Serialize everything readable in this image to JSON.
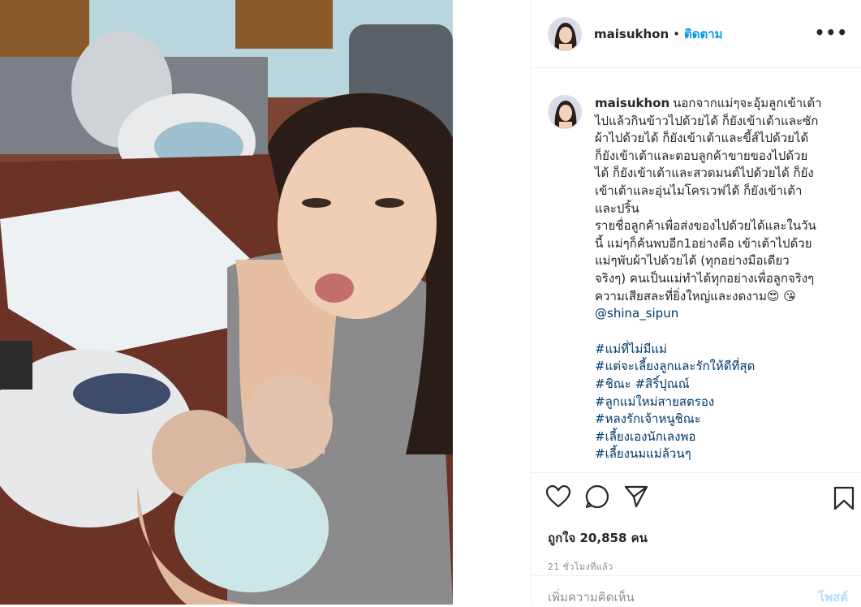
{
  "post": {
    "username": "maisukhon",
    "separator": "•",
    "follow_label": "ติดตาม",
    "more_icon": "more-icon",
    "more_glyph": "•••"
  },
  "caption": {
    "username": "maisukhon",
    "lines": [
      "นอกจากแม่ๆจะอุ้มลูกเข้าเต้า",
      "ไปแล้วกินข้าวไปด้วยได้ ก็ยังเข้าเต้าและซัก",
      "ผ้าไปด้วยได้ ก็ยังเข้าเต้าและขี้ส์ไปด้วยได้",
      "ก็ยังเข้าเต้าและตอบลูกค้าขายของไปด้วย",
      "ได้ ก็ยังเข้าเต้าและสวดมนต์ไปด้วยได้ ก็ยัง",
      "เข้าเต้าและอุ่นไมโครเวฟได้ ก็ยังเข้าเต้า",
      "และปริ้น",
      "รายชื่อลูกค้าเพื่อส่งของไปด้วยได้และในวัน",
      "นี้ แม่ๆก็ค้นพบอีก1อย่างคือ เข้าเต้าไปด้วย",
      "แม่ๆพับผ้าไปด้วยได้ (ทุกอย่างมือเดียว",
      "จริงๆ) คนเป็นแม่ทำได้ทุกอย่างเพื่อลูกจริงๆ",
      "ความเสียสละที่ยิ่งใหญ่และงดงาม😍 😘"
    ],
    "mention": "@shina_sipun",
    "hashtags": [
      "#แม่ที่ไม่มีแม่",
      "#แต่จะเลี้ยงลูกและรักให้ดีที่สุด",
      "#ชิณะ #สิริ์ปุณณ์",
      "#ลูกแม่ใหม่สายสตรอง",
      "#หลงรักเจ้าหนูชิณะ",
      "#เลี้ยงเองนักเลงพอ",
      "#เลี้ยงนมแม่ล้วนๆ"
    ]
  },
  "actions": {
    "like_icon": "heart-icon",
    "comment_icon": "comment-icon",
    "share_icon": "share-icon",
    "save_icon": "bookmark-icon"
  },
  "likes": "ถูกใจ 20,858 คน",
  "timestamp": "21 ชั่วโมงที่แล้ว",
  "comment_input": {
    "placeholder": "เพิ่มความคิดเห็น",
    "post_label": "โพสต์"
  },
  "colors": {
    "link": "#00376b",
    "follow": "#0095f6",
    "post_disabled": "#b2dffc",
    "muted": "#8e8e8e"
  }
}
